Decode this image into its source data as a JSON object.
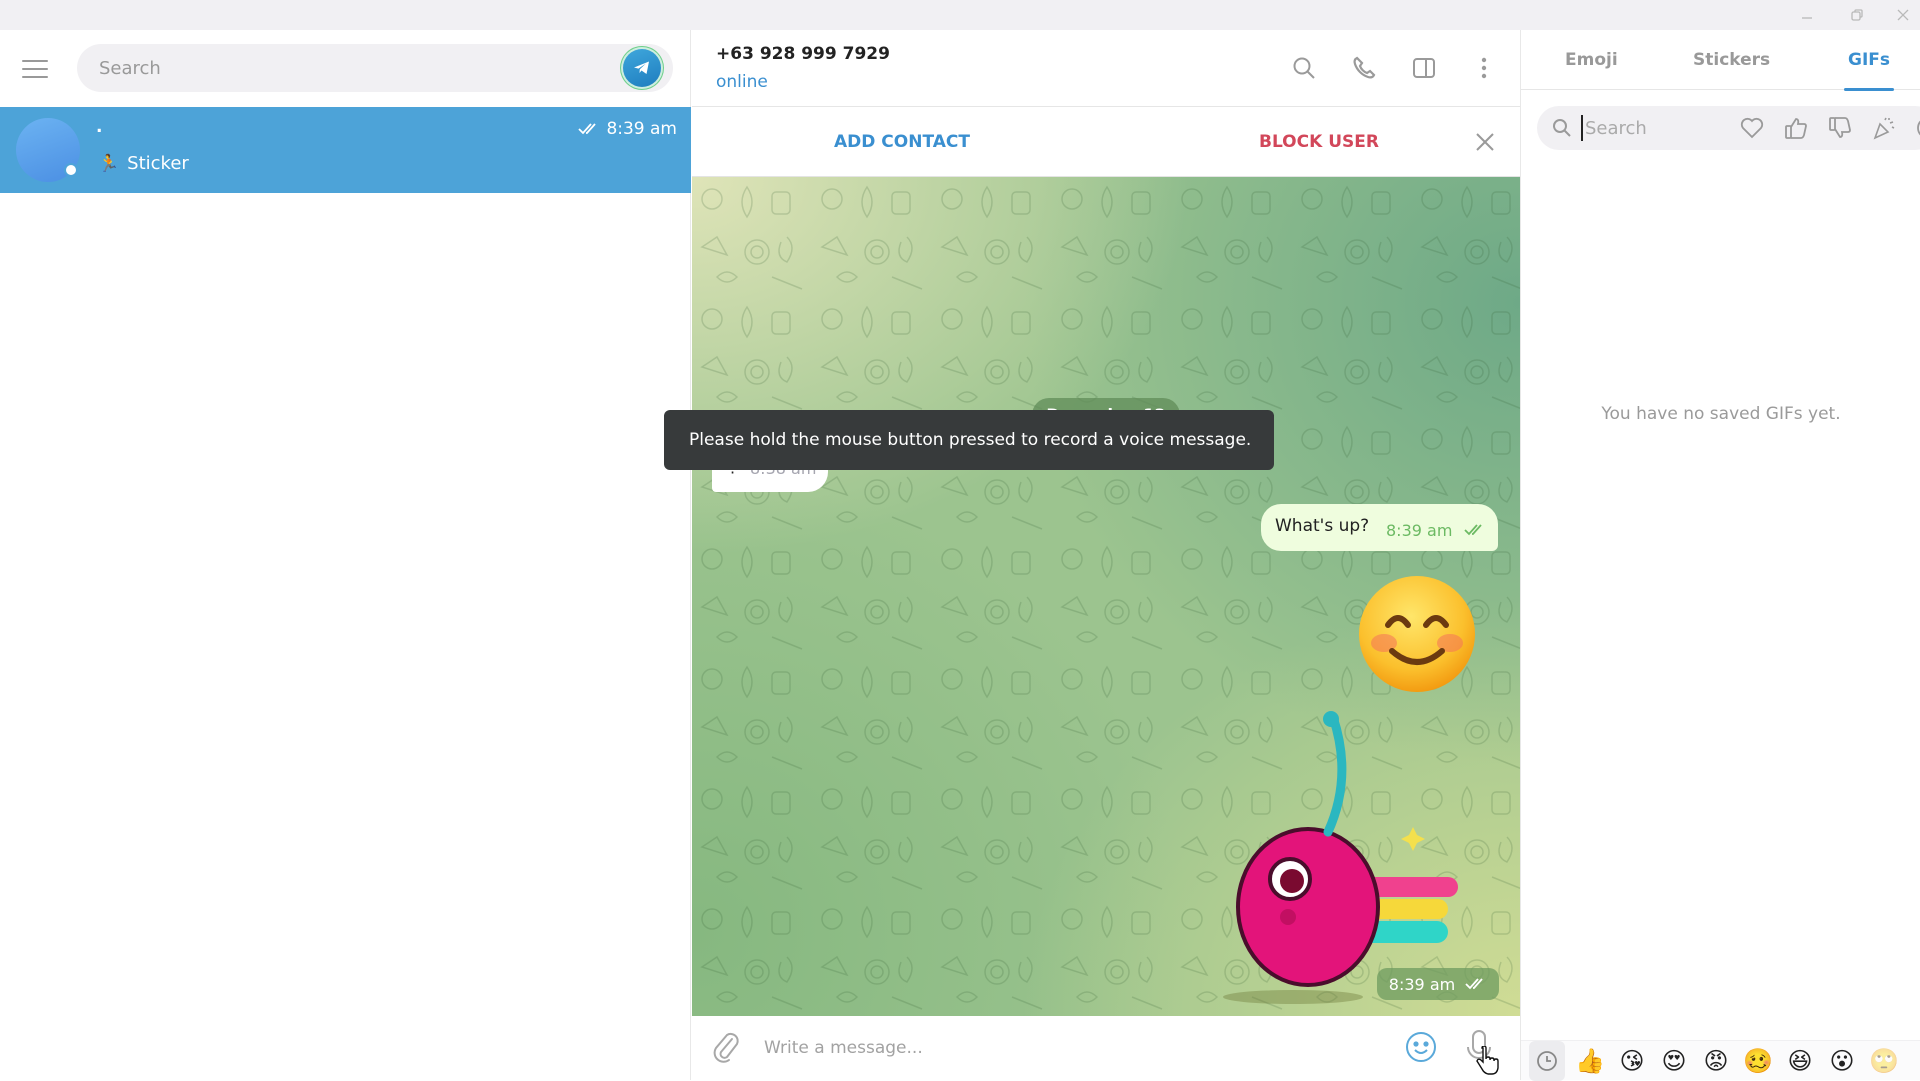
{
  "window": {
    "controls": [
      {
        "name": "minimize",
        "icon": "minimize-icon"
      },
      {
        "name": "restore",
        "icon": "restore-icon"
      },
      {
        "name": "close",
        "icon": "close-icon"
      }
    ]
  },
  "sidebar": {
    "search_placeholder": "Search",
    "chats": [
      {
        "name": ".",
        "time": "8:39 am",
        "status": "read",
        "preview_emoji": "🏃",
        "preview": "Sticker",
        "selected": true,
        "online": true
      }
    ]
  },
  "chat": {
    "peer_name": "+63 928 999 7929",
    "peer_status": "online",
    "header_icons": [
      "search-icon",
      "phone-icon",
      "sidebar-toggle-icon",
      "more-vertical-icon"
    ],
    "action_bar": {
      "add_contact": "ADD CONTACT",
      "block_user": "BLOCK USER"
    },
    "date_separator": "December 12",
    "messages": [
      {
        "direction": "in",
        "text": "·",
        "time": "8:38 am"
      },
      {
        "direction": "out",
        "text": "What's up?",
        "time": "8:39 am",
        "status": "read"
      },
      {
        "direction": "out",
        "type": "emoji",
        "emoji": "😊"
      },
      {
        "direction": "out",
        "type": "sticker",
        "description": "cherry",
        "time": "8:39 am",
        "status": "read"
      }
    ],
    "tooltip": "Please hold the mouse button pressed to record a voice message.",
    "composer_placeholder": "Write a message..."
  },
  "panel": {
    "tabs": [
      {
        "label": "Emoji",
        "active": false
      },
      {
        "label": "Stickers",
        "active": false
      },
      {
        "label": "GIFs",
        "active": true
      }
    ],
    "search_placeholder": "Search",
    "categories": [
      "heart-icon",
      "thumbs-up-icon",
      "thumbs-down-icon",
      "party-icon",
      "smile-icon"
    ],
    "empty_message": "You have no saved GIFs yet.",
    "strip": [
      "recent-icon",
      "👍",
      "😘",
      "😍",
      "😡",
      "🥴",
      "😆",
      "😮",
      "🙄"
    ]
  },
  "colors": {
    "accent": "#3a8fd0",
    "selected_chat": "#4da3d8",
    "danger": "#d2475a",
    "outgoing_bubble": "#effdde",
    "tooltip_bg": "#373a3b"
  }
}
